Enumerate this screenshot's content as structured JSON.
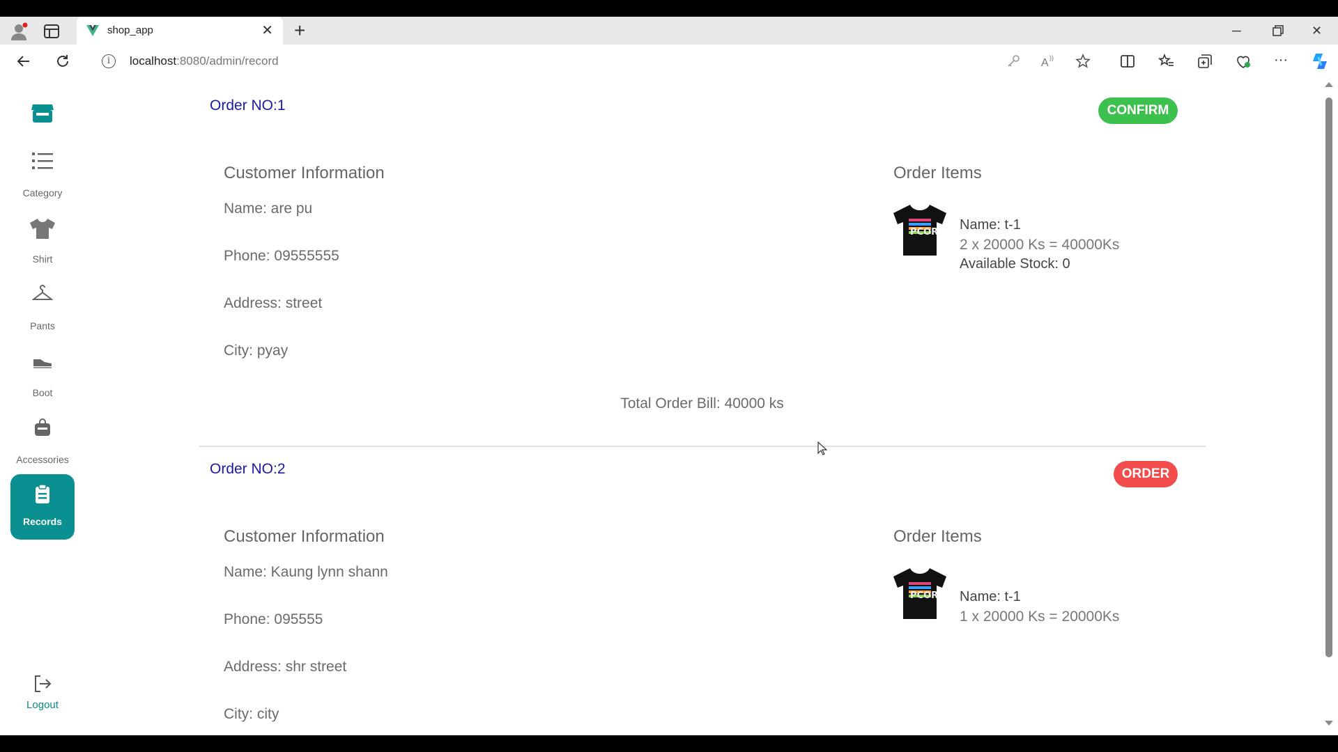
{
  "browser": {
    "tab_title": "shop_app",
    "url_host": "localhost",
    "url_rest": ":8080/admin/record"
  },
  "sidebar": {
    "items": [
      {
        "label": "Category",
        "icon": "list-icon"
      },
      {
        "label": "Shirt",
        "icon": "shirt-icon"
      },
      {
        "label": "Pants",
        "icon": "hanger-icon"
      },
      {
        "label": "Boot",
        "icon": "shoe-icon"
      },
      {
        "label": "Accessories",
        "icon": "bag-icon"
      },
      {
        "label": "Records",
        "icon": "clipboard-icon",
        "active": true
      }
    ],
    "logout_label": "Logout",
    "accent_color": "#0a9090"
  },
  "orders": [
    {
      "order_no": "Order NO:1",
      "status": "CONFIRM",
      "status_color": "#3dc14e",
      "customer_title": "Customer Information",
      "name": "Name: are pu",
      "phone": "Phone: 09555555",
      "address": "Address: street",
      "city": "City: pyay",
      "items_title": "Order Items",
      "item_name": "Name: t-1",
      "item_calc": "2 x 20000 Ks = 40000Ks",
      "item_stock": "Available Stock: 0",
      "total": "Total Order Bill: 40000 ks"
    },
    {
      "order_no": "Order NO:2",
      "status": "ORDER",
      "status_color": "#f24b4b",
      "customer_title": "Customer Information",
      "name": "Name: Kaung lynn shann",
      "phone": "Phone: 095555",
      "address": "Address: shr street",
      "city": "City: city",
      "items_title": "Order Items",
      "item_name": "Name: t-1",
      "item_calc": "1 x 20000 Ks = 20000Ks"
    }
  ]
}
